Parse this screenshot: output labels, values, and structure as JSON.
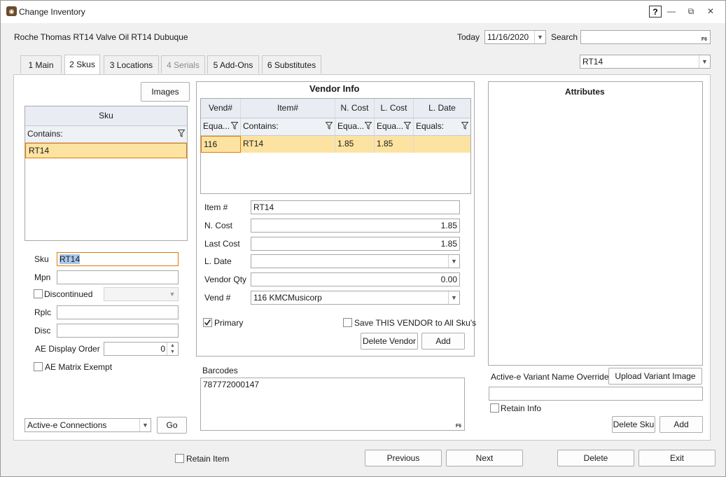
{
  "window": {
    "title": "Change Inventory",
    "help": "?",
    "minimize": "—",
    "restore": "⧉",
    "close": "✕"
  },
  "header": {
    "item_desc": "Roche Thomas RT14 Valve Oil RT14 Dubuque",
    "today_label": "Today",
    "today_value": "11/16/2020",
    "search_label": "Search",
    "search_value": "",
    "search_hotkey": "F6"
  },
  "tabs": [
    {
      "label": "1 Main"
    },
    {
      "label": "2 Skus"
    },
    {
      "label": "3 Locations"
    },
    {
      "label": "4 Serials"
    },
    {
      "label": "5 Add-Ons"
    },
    {
      "label": "6 Substitutes"
    }
  ],
  "sku_selector": "RT14",
  "left": {
    "images_button": "Images",
    "grid_header": "Sku",
    "filter_label": "Contains:",
    "rows": [
      "RT14"
    ],
    "sku_label": "Sku",
    "sku_value": "RT14",
    "mpn_label": "Mpn",
    "mpn_value": "",
    "discontinued_label": "Discontinued",
    "discontinued_value": "",
    "rplc_label": "Rplc",
    "rplc_value": "",
    "disc_label": "Disc",
    "disc_value": "",
    "ae_order_label": "AE Display Order",
    "ae_order_value": "0",
    "ae_matrix_label": "AE Matrix Exempt",
    "connections_value": "Active-e Connections",
    "go_button": "Go"
  },
  "vendor": {
    "title": "Vendor Info",
    "columns": [
      "Vend#",
      "Item#",
      "N. Cost",
      "L. Cost",
      "L. Date"
    ],
    "filters": [
      "Equa...",
      "Contains:",
      "Equa...",
      "Equa...",
      "Equals:"
    ],
    "rows": [
      [
        "116",
        "RT14",
        "1.85",
        "1.85",
        ""
      ]
    ],
    "item_label": "Item #",
    "item_value": "RT14",
    "ncost_label": "N. Cost",
    "ncost_value": "1.85",
    "lastcost_label": "Last Cost",
    "lastcost_value": "1.85",
    "ldate_label": "L. Date",
    "ldate_value": "",
    "qty_label": "Vendor Qty",
    "qty_value": "0.00",
    "vend_label": "Vend #",
    "vend_value": "116 KMCMusicorp",
    "primary_label": "Primary",
    "save_all_label": "Save THIS VENDOR to All Sku's",
    "delete_button": "Delete Vendor",
    "add_button": "Add"
  },
  "barcodes": {
    "label": "Barcodes",
    "value": "787772000147",
    "hotkey": "F6"
  },
  "attributes": {
    "title": "Attributes",
    "override_label": "Active-e Variant Name Override",
    "override_value": "",
    "upload_button": "Upload Variant Image",
    "retain_info_label": "Retain Info",
    "delete_sku_button": "Delete Sku",
    "add_button": "Add"
  },
  "footer": {
    "retain_item_label": "Retain Item",
    "previous": "Previous",
    "next": "Next",
    "delete": "Delete",
    "exit": "Exit"
  }
}
